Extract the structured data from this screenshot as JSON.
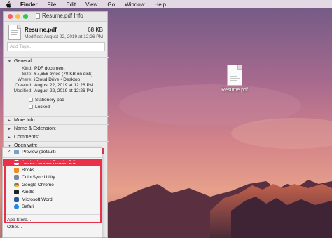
{
  "menubar": {
    "items": [
      "Finder",
      "File",
      "Edit",
      "View",
      "Go",
      "Window",
      "Help"
    ]
  },
  "window": {
    "title": "Resume.pdf Info",
    "file_name": "Resume.pdf",
    "file_size": "68 KB",
    "modified_line": "Modified: August 22, 2019 at 12:26 PM",
    "tags_placeholder": "Add Tags..."
  },
  "general": {
    "header": "General:",
    "rows": [
      {
        "key": "Kind:",
        "value": "PDF document"
      },
      {
        "key": "Size:",
        "value": "67,656 bytes (70 KB on disk)"
      },
      {
        "key": "Where:",
        "value": "iCloud Drive • Desktop"
      },
      {
        "key": "Created:",
        "value": "August 22, 2019 at 12:26 PM"
      },
      {
        "key": "Modified:",
        "value": "August 22, 2019 at 12:26 PM"
      }
    ],
    "stationery_label": "Stationery pad",
    "locked_label": "Locked"
  },
  "sections": {
    "more_info": "More Info:",
    "name_extension": "Name & Extension:",
    "comments": "Comments:",
    "open_with": "Open with:"
  },
  "open_with_menu": {
    "current": "Preview (default)",
    "apps": [
      {
        "label": "Adobe Acrobat Reader DC",
        "color": "#d8232a"
      },
      {
        "label": "Books",
        "color": "#f28a1c"
      },
      {
        "label": "ColorSync Utility",
        "color": "#7a8a9a"
      },
      {
        "label": "Google Chrome",
        "color": "#34a853"
      },
      {
        "label": "Kindle",
        "color": "#222222"
      },
      {
        "label": "Microsoft Word",
        "color": "#2b579a"
      },
      {
        "label": "Safari",
        "color": "#1e88e5"
      }
    ],
    "app_store": "App Store...",
    "other": "Other..."
  },
  "desktop": {
    "file_label": "Resume.pdf"
  },
  "colors": {
    "highlight": "#e8314b"
  }
}
